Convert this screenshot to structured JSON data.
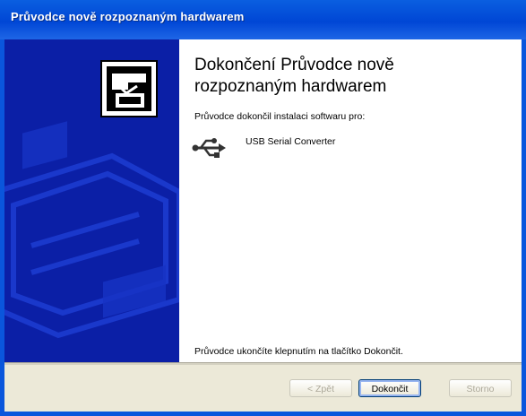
{
  "window": {
    "title": "Průvodce nově rozpoznaným hardwarem"
  },
  "content": {
    "heading": "Dokončení Průvodce nově rozpoznaným hardwarem",
    "intro": "Průvodce dokončil instalaci softwaru pro:",
    "device_name": "USB Serial Converter",
    "device_icon": "usb-icon",
    "finish_hint": "Průvodce ukončíte klepnutím na tlačítko Dokončit."
  },
  "buttons": {
    "back": "< Zpět",
    "finish": "Dokončit",
    "cancel": "Storno"
  },
  "colors": {
    "titlebar": "#0a5fe0",
    "sidebar": "#0b1fa6",
    "dialog_bg": "#ece9d8"
  }
}
